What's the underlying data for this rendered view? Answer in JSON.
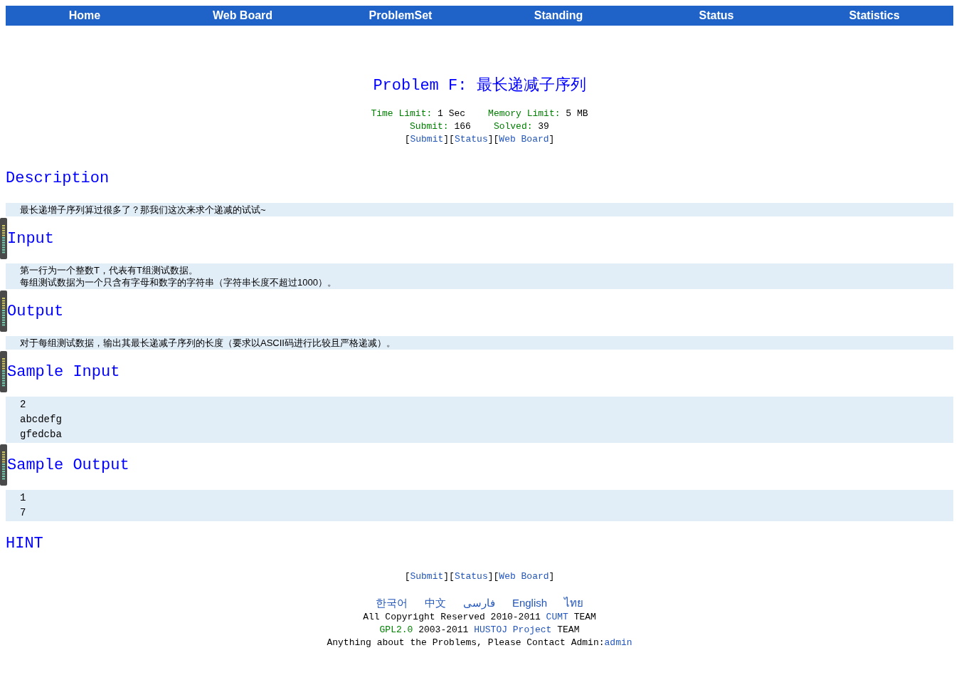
{
  "nav": [
    {
      "label": "Home"
    },
    {
      "label": "Web Board"
    },
    {
      "label": "ProblemSet"
    },
    {
      "label": "Standing"
    },
    {
      "label": "Status"
    },
    {
      "label": "Statistics"
    }
  ],
  "problem": {
    "title": "Problem F: 最长递减子序列",
    "limits": [
      {
        "label": "Time Limit: ",
        "value": "1 Sec"
      },
      {
        "label": "Memory Limit: ",
        "value": "5 MB"
      }
    ],
    "stats": [
      {
        "label": "Submit: ",
        "value": "166"
      },
      {
        "label": "Solved: ",
        "value": "39"
      }
    ],
    "links": [
      {
        "open": "[",
        "label": "Submit",
        "close": "]"
      },
      {
        "open": "[",
        "label": "Status",
        "close": "]"
      },
      {
        "open": "[",
        "label": "Web Board",
        "close": "]"
      }
    ]
  },
  "sections": [
    {
      "heading": "Description",
      "kind": "text",
      "meter": false,
      "lines": [
        "最长递增子序列算过很多了？那我们这次来求个递减的试试~"
      ]
    },
    {
      "heading": "Input",
      "kind": "text",
      "meter": true,
      "lines": [
        "第一行为一个整数T，代表有T组测试数据。",
        "每组测试数据为一个只含有字母和数字的字符串（字符串长度不超过1000）。"
      ]
    },
    {
      "heading": "Output",
      "kind": "text",
      "meter": true,
      "lines": [
        "对于每组测试数据，输出其最长递减子序列的长度（要求以ASCII码进行比较且严格递减）。"
      ]
    },
    {
      "heading": "Sample Input",
      "kind": "code",
      "meter": true,
      "lines": [
        "2",
        "abcdefg",
        "gfedcba"
      ]
    },
    {
      "heading": "Sample Output",
      "kind": "code",
      "meter": true,
      "lines": [
        "1",
        "7"
      ]
    },
    {
      "heading": "HINT",
      "kind": "empty",
      "meter": false
    }
  ],
  "footer_links": [
    {
      "open": "[",
      "label": "Submit",
      "close": "]"
    },
    {
      "open": "[",
      "label": "Status",
      "close": "]"
    },
    {
      "open": "[",
      "label": "Web Board",
      "close": "]"
    }
  ],
  "languages": [
    "한국어",
    "中文",
    "فارسی",
    "English",
    "ไทย"
  ],
  "copyright": [
    {
      "before": "All Copyright Reserved 2010-2011 ",
      "link": "CUMT",
      "after": " TEAM"
    },
    {
      "lead": "GPL2.0",
      "before": " 2003-2011 ",
      "link": "HUSTOJ Project",
      "after": " TEAM"
    },
    {
      "before": "Anything about the Problems, Please Contact Admin:",
      "link": "admin"
    }
  ]
}
